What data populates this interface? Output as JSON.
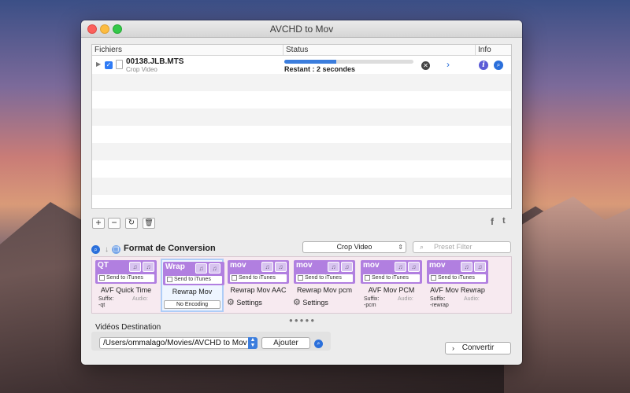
{
  "window": {
    "title": "AVCHD to Mov"
  },
  "filelist": {
    "columns": {
      "files": "Fichiers",
      "status": "Status",
      "info": "Info"
    },
    "rows": [
      {
        "name": "00138.JLB.MTS",
        "preset": "Crop Video",
        "progress": 0.4,
        "status": "Restant : 2 secondes"
      }
    ]
  },
  "toolbar": {
    "add": "+",
    "remove": "−"
  },
  "format": {
    "title": "Format de Conversion",
    "selected_preset": "Crop Video",
    "filter_placeholder": "Preset Filter"
  },
  "presets": [
    {
      "badge": "QT",
      "itunes": "Send to iTunes",
      "label": "AVF Quick Time",
      "suffix_label": "Suffix:",
      "suffix": "-qt",
      "audio": "Audio:"
    },
    {
      "badge": "Wrap",
      "itunes": "Send to iTunes",
      "label": "Rewrap Mov",
      "encoding": "No Encoding"
    },
    {
      "badge": "mov",
      "itunes": "Send to iTunes",
      "label": "Rewrap Mov AAC",
      "settings": "Settings"
    },
    {
      "badge": "mov",
      "itunes": "Send to iTunes",
      "label": "Rewrap Mov pcm",
      "settings": "Settings"
    },
    {
      "badge": "mov",
      "itunes": "Send to iTunes",
      "label": "AVF Mov PCM",
      "suffix_label": "Suffix:",
      "suffix": "-pcm",
      "audio": "Audio:"
    },
    {
      "badge": "mov",
      "itunes": "Send to iTunes",
      "label": "AVF Mov Rewrap",
      "suffix_label": "Suffix:",
      "suffix": "-rewrap",
      "audio": "Audio:"
    }
  ],
  "destination": {
    "title": "Vidéos Destination",
    "path": "/Users/ommalago/Movies/AVCHD to Mov",
    "add_label": "Ajouter"
  },
  "convert_label": "Convertir",
  "colors": {
    "progress": "#3b7ddd",
    "badge": "#b17fe0",
    "accent": "#2a6fdb"
  }
}
